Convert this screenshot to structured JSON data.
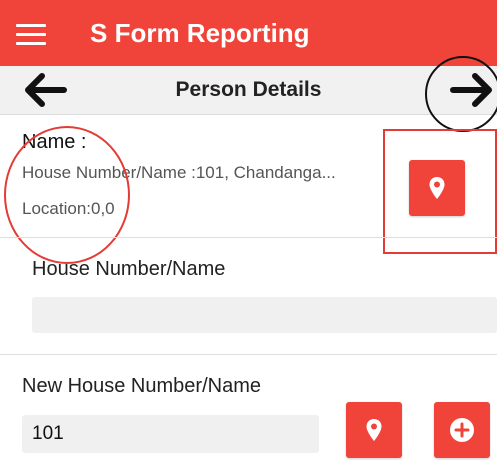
{
  "app": {
    "title": "S Form Reporting",
    "accent_color": "#f0443a"
  },
  "toolbar": {
    "page_title": "Person Details",
    "back_icon": "arrow-left-icon",
    "forward_icon": "arrow-right-icon"
  },
  "summary": {
    "name_label": "Name :",
    "house_line": "House Number/Name :101, Chandanga...",
    "location_line": "Location:0,0",
    "pin_icon": "map-pin-icon"
  },
  "form": {
    "house_number": {
      "label": "House Number/Name",
      "value": ""
    },
    "new_house_number": {
      "label": "New House Number/Name",
      "value": "101",
      "pin_icon": "map-pin-icon",
      "add_icon": "plus-circle-icon"
    }
  }
}
